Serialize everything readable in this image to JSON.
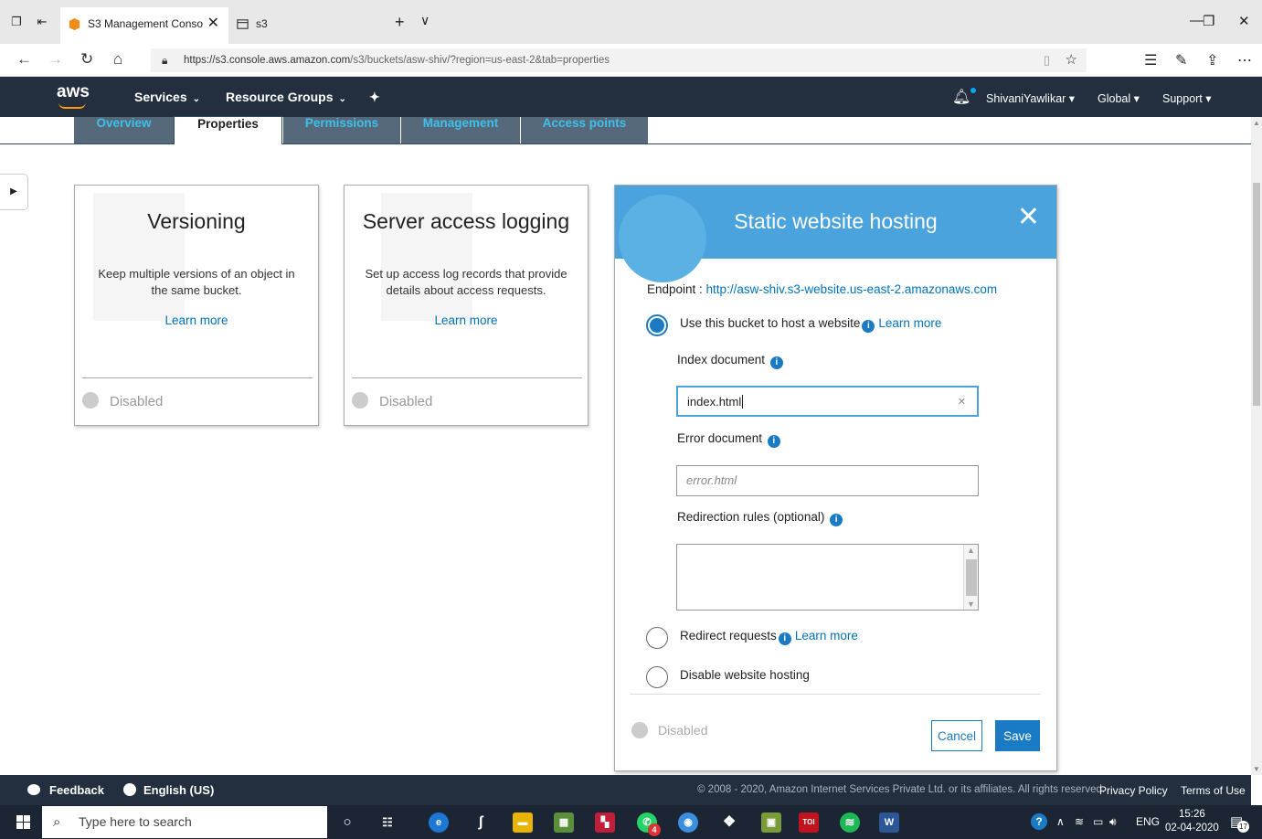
{
  "browser": {
    "tabs": [
      {
        "title": "S3 Management Conso",
        "active": true
      },
      {
        "title": "s3",
        "active": false
      }
    ],
    "url_host": "https://s3.console.aws.amazon.com",
    "url_path": "/s3/buckets/asw-shiv/?region=us-east-2&tab=properties"
  },
  "aws_nav": {
    "logo": "aws",
    "services": "Services",
    "resource_groups": "Resource Groups",
    "user": "ShivaniYawlikar",
    "region": "Global",
    "support": "Support"
  },
  "bucket_tabs": [
    "Overview",
    "Properties",
    "Permissions",
    "Management",
    "Access points"
  ],
  "cards": [
    {
      "title": "Versioning",
      "description": "Keep multiple versions of an object in the same bucket.",
      "link": "Learn more",
      "status": "Disabled"
    },
    {
      "title": "Server access logging",
      "description": "Set up access log records that provide details about access requests.",
      "link": "Learn more",
      "status": "Disabled"
    }
  ],
  "static_hosting": {
    "title": "Static website hosting",
    "endpoint_label": "Endpoint : ",
    "endpoint_url": "http://asw-shiv.s3-website.us-east-2.amazonaws.com",
    "options": [
      {
        "label": "Use this bucket to host a website",
        "link": "Learn more",
        "selected": true
      },
      {
        "label": "Redirect requests",
        "link": "Learn more",
        "selected": false
      },
      {
        "label": "Disable website hosting",
        "link": "",
        "selected": false
      }
    ],
    "index_label": "Index document",
    "index_value": "index.html",
    "error_label": "Error document",
    "error_placeholder": "error.html",
    "redirection_label": "Redirection rules (optional)",
    "status": "Disabled",
    "cancel": "Cancel",
    "save": "Save"
  },
  "footer": {
    "feedback": "Feedback",
    "language": "English (US)",
    "copyright": "© 2008 - 2020, Amazon Internet Services Private Ltd. or its affiliates. All rights reserved.",
    "privacy": "Privacy Policy",
    "terms": "Terms of Use"
  },
  "taskbar": {
    "search_placeholder": "Type here to search",
    "lang": "ENG",
    "time": "15:26",
    "date": "02-04-2020",
    "notif_count": "17",
    "whatsapp_badge": "4"
  },
  "colors": {
    "aws_nav": "#232f3e",
    "tab_inactive": "#55697a",
    "tab_text": "#3ec0ea",
    "accent": "#1a7bc4",
    "panel_header": "#4aa3dd",
    "link": "#0073bb"
  }
}
